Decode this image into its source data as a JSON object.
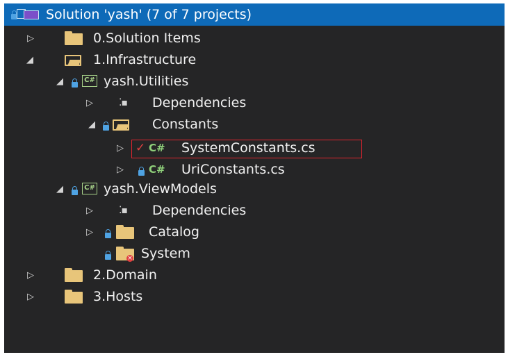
{
  "solution": {
    "title": "Solution 'yash' (7 of 7 projects)"
  },
  "tree": {
    "solution_items": "0.Solution Items",
    "infrastructure": "1.Infrastructure",
    "utilities_project": "yash.Utilities",
    "utilities_dependencies": "Dependencies",
    "constants_folder": "Constants",
    "cs_glyph": "C#",
    "project_glyph": "C#",
    "system_constants": "SystemConstants.cs",
    "uri_constants": "UriConstants.cs",
    "viewmodels_project": "yash.ViewModels",
    "viewmodels_dependencies": "Dependencies",
    "catalog_folder": "Catalog",
    "system_folder": "System",
    "domain": "2.Domain",
    "hosts": "3.Hosts"
  },
  "glyphs": {
    "expand_right": "▷",
    "expand_down": "◢",
    "check": "✓",
    "deps": "⁚▪"
  },
  "colors": {
    "background": "#252526",
    "header": "#0e6ab8",
    "selection_outline": "#e0242e",
    "folder": "#e8c57a",
    "csharp": "#8fd07a"
  }
}
